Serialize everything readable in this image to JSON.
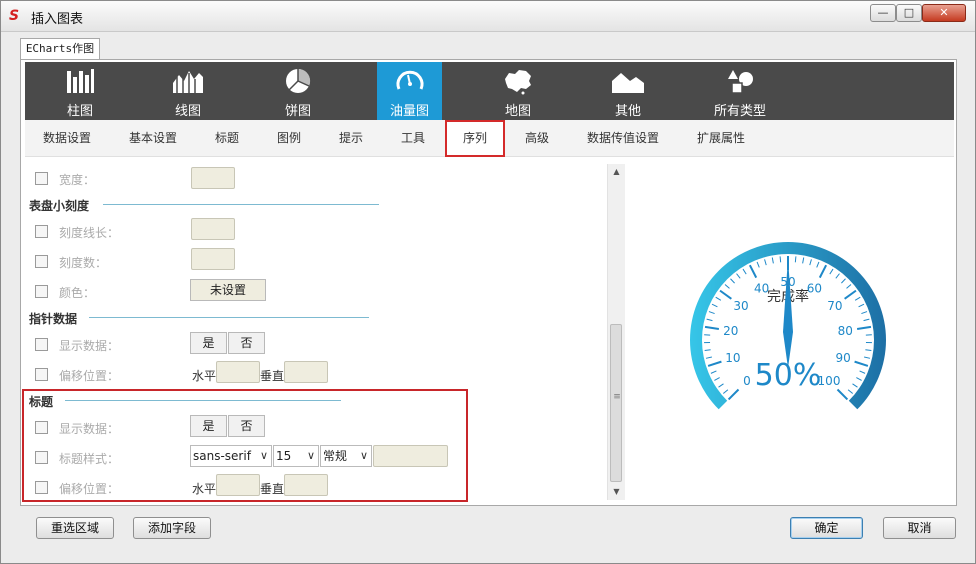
{
  "window": {
    "title": "插入图表",
    "min_glyph": "—",
    "max_glyph": "□",
    "close_glyph": "✕"
  },
  "tab": {
    "label": "ECharts作图"
  },
  "chart_types": [
    {
      "label": "柱图",
      "icon": "bar-chart-icon"
    },
    {
      "label": "线图",
      "icon": "area-chart-icon"
    },
    {
      "label": "饼图",
      "icon": "pie-chart-icon"
    },
    {
      "label": "油量图",
      "icon": "gauge-icon",
      "active": true
    },
    {
      "label": "地图",
      "icon": "china-map-icon"
    },
    {
      "label": "其他",
      "icon": "mountain-icon"
    },
    {
      "label": "所有类型",
      "icon": "shapes-icon"
    }
  ],
  "subtabs": [
    "数据设置",
    "基本设置",
    "标题",
    "图例",
    "提示",
    "工具",
    "序列",
    "高级",
    "数据传值设置",
    "扩展属性"
  ],
  "selected_subtab": "序列",
  "settings": {
    "width_label": "宽度：",
    "section_minor_ticks": "表盘小刻度",
    "tick_length_label": "刻度线长：",
    "tick_count_label": "刻度数：",
    "color_label": "颜色：",
    "color_value": "未设置",
    "section_pointer": "指针数据",
    "pointer_show_label": "显示数据：",
    "yes": "是",
    "no": "否",
    "pointer_offset_label": "偏移位置：",
    "horizontal": "水平",
    "vertical": "垂直",
    "section_title": "标题",
    "title_show_label": "显示数据：",
    "title_style_label": "标题样式：",
    "font_family": "sans-serif",
    "font_size": "15",
    "font_weight": "常规",
    "title_offset_label": "偏移位置："
  },
  "gauge": {
    "title": "完成率",
    "value_text": "50%",
    "value": 50,
    "min": 0,
    "max": 100,
    "tick_labels": [
      "0",
      "10",
      "20",
      "30",
      "40",
      "50",
      "60",
      "70",
      "80",
      "90",
      "100"
    ],
    "color_light": "#36c6e8",
    "color_dark": "#1d6fa5",
    "label_color": "#1e88c8"
  },
  "footer": {
    "reselect": "重选区域",
    "add_field": "添加字段",
    "ok": "确定",
    "cancel": "取消"
  },
  "colors": {
    "accent": "#1e9ad6",
    "toolbar": "#4a4a4a",
    "highlight": "#c8262a"
  }
}
